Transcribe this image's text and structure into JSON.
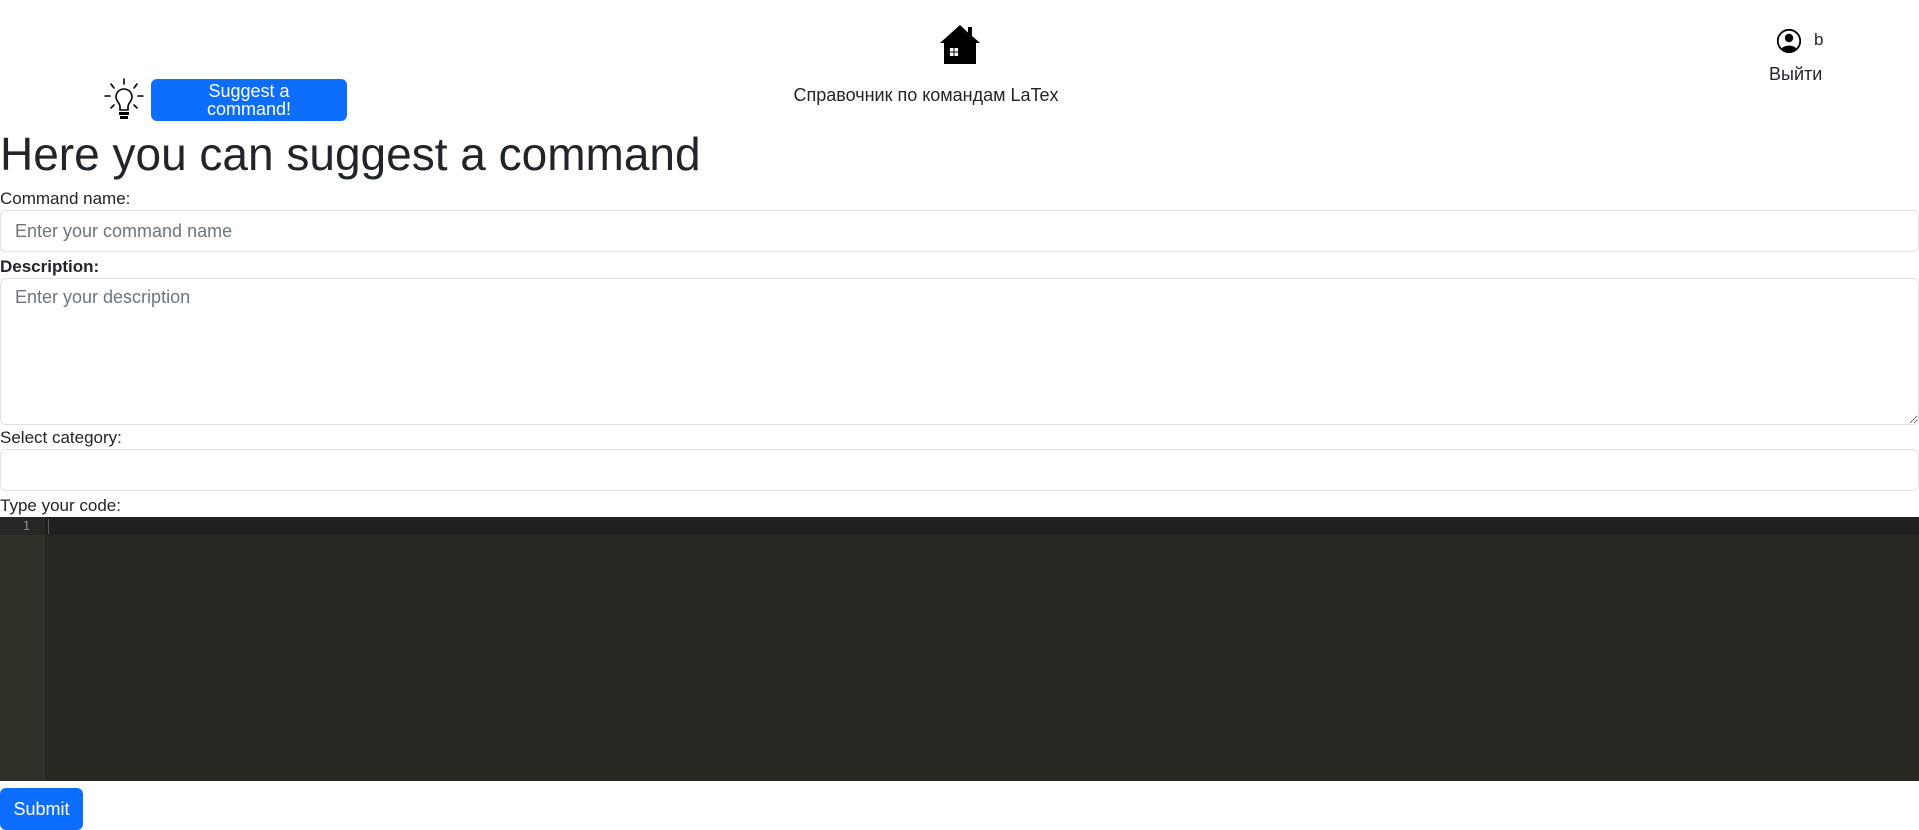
{
  "header": {
    "suggest_button_label": "Suggest a command!",
    "site_title": "Справочник по командам LaTex",
    "username": "b",
    "logout_label": "Выйти"
  },
  "main": {
    "heading": "Here you can suggest a command",
    "command_name": {
      "label": "Command name:",
      "placeholder": "Enter your command name",
      "value": ""
    },
    "description": {
      "label": "Description:",
      "placeholder": "Enter your description",
      "value": ""
    },
    "category": {
      "label": "Select category:",
      "selected": ""
    },
    "code": {
      "label": "Type your code:",
      "line_numbers": [
        "1"
      ]
    },
    "submit_label": "Submit"
  },
  "colors": {
    "primary": "#0d6efd",
    "editor_background": "#272822",
    "editor_gutter": "#2f3129",
    "text": "#212529"
  },
  "icons": {
    "suggest": "lightbulb-icon",
    "home": "house-icon",
    "user": "person-circle-icon"
  }
}
